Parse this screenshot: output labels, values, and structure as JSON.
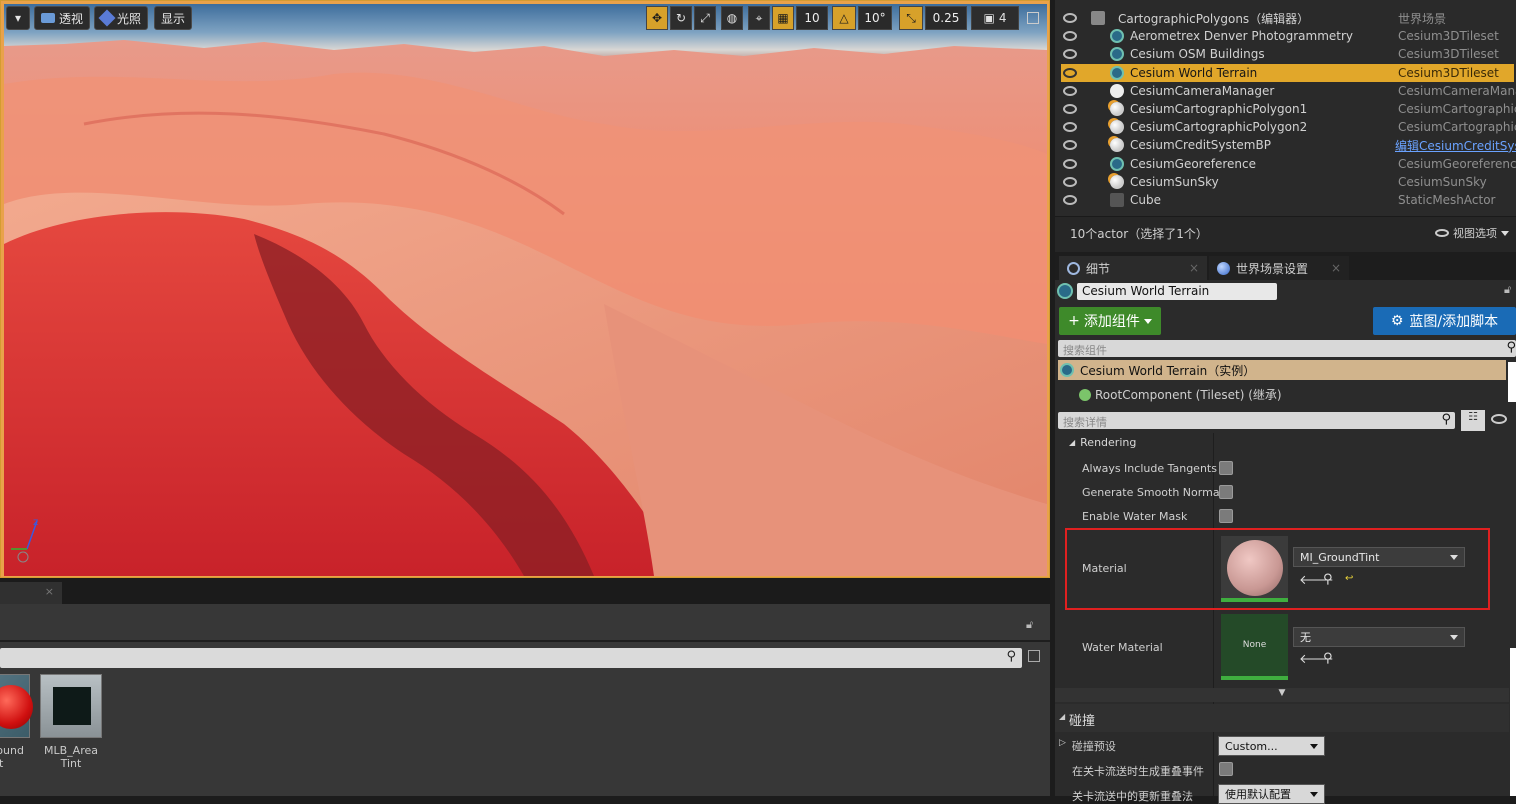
{
  "viewport": {
    "perspective_label": "透视",
    "lit_label": "光照",
    "show_label": "显示",
    "grid_snap": "10",
    "rotate_snap": "10°",
    "scale_snap": "0.25",
    "camera_speed": "4"
  },
  "content_browser": {
    "assets": [
      {
        "label": "round\nnt"
      },
      {
        "label": "MLB_Area\nTint"
      }
    ]
  },
  "outliner": {
    "items": [
      {
        "name": "CartographicPolygons（编辑器）",
        "type": "世界场景",
        "icon": "level-icon"
      },
      {
        "name": "Aerometrex Denver Photogrammetry",
        "type": "Cesium3DTileset",
        "icon": "tileset-icon"
      },
      {
        "name": "Cesium OSM Buildings",
        "type": "Cesium3DTileset",
        "icon": "tileset-icon"
      },
      {
        "name": "Cesium World Terrain",
        "type": "Cesium3DTileset",
        "icon": "tileset-icon",
        "selected": true
      },
      {
        "name": "CesiumCameraManager",
        "type": "CesiumCameraManage",
        "icon": "actor-icon"
      },
      {
        "name": "CesiumCartographicPolygon1",
        "type": "CesiumCartographicPo",
        "icon": "polygon-icon"
      },
      {
        "name": "CesiumCartographicPolygon2",
        "type": "CesiumCartographicPo",
        "icon": "polygon-icon"
      },
      {
        "name": "CesiumCreditSystemBP",
        "type": "编辑CesiumCreditSys",
        "icon": "polygon-icon",
        "link": true
      },
      {
        "name": "CesiumGeoreference",
        "type": "CesiumGeoreference",
        "icon": "tileset-icon"
      },
      {
        "name": "CesiumSunSky",
        "type": "CesiumSunSky",
        "icon": "polygon-icon"
      },
      {
        "name": "Cube",
        "type": "StaticMeshActor",
        "icon": "mesh-icon"
      }
    ],
    "footer_count": "10个actor（选择了1个）",
    "view_options": "视图选项"
  },
  "details": {
    "tab_details": "细节",
    "tab_world": "世界场景设置",
    "actor_name": "Cesium World Terrain",
    "add_component": "添加组件",
    "blueprint": "蓝图/添加脚本",
    "search_components_placeholder": "搜索组件",
    "instance_label": "Cesium World Terrain（实例）",
    "root_component": "RootComponent (Tileset) (继承)",
    "search_details_placeholder": "搜索详情",
    "rendering_header": "Rendering",
    "props": {
      "always_include_tangents": "Always Include Tangents",
      "generate_smooth_normals": "Generate Smooth Normals",
      "enable_water_mask": "Enable Water Mask",
      "material": "Material",
      "material_value": "MI_GroundTint",
      "water_material": "Water Material",
      "water_material_value": "无",
      "none_thumb": "None"
    },
    "collision_header": "碰撞",
    "collision_preset": "碰撞预设",
    "collision_preset_value": "Custom...",
    "gen_overlap": "在关卡流送时生成重叠事件",
    "level_stream_label": "关卡流送中的更新重叠法",
    "level_stream_value": "使用默认配置"
  },
  "colors": {
    "accent": "#e1a72a",
    "highlight_box": "#e02020",
    "add_component_bg": "#3e8a2a",
    "blueprint_bg": "#1a6bb6"
  }
}
